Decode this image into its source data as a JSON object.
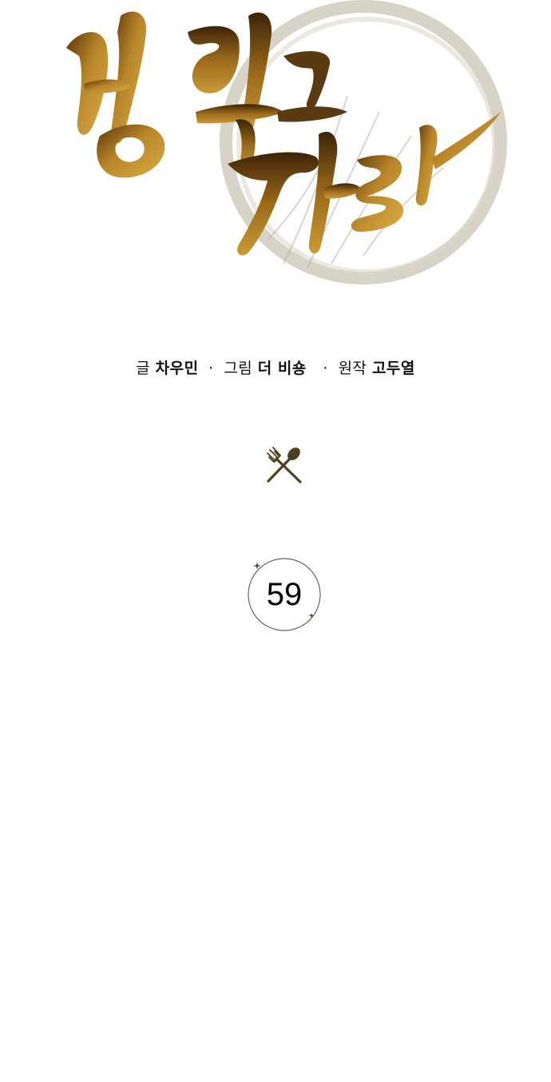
{
  "title": {
    "text": "밥 먹고 가라",
    "brush_colors": [
      "#8a5a12",
      "#c99a2e",
      "#3a2208"
    ],
    "ring_color": "#b8b3a2"
  },
  "credits": {
    "story_label": "글",
    "story_name": "차우민",
    "art_label": "그림",
    "art_name": "더 비숑",
    "original_label": "원작",
    "original_name": "고두열",
    "separator": "·"
  },
  "divider": {
    "icon": "fork-and-spoon-icon",
    "color": "#4d4020"
  },
  "episode": {
    "number": "59",
    "ring_color": "#6b6454"
  }
}
